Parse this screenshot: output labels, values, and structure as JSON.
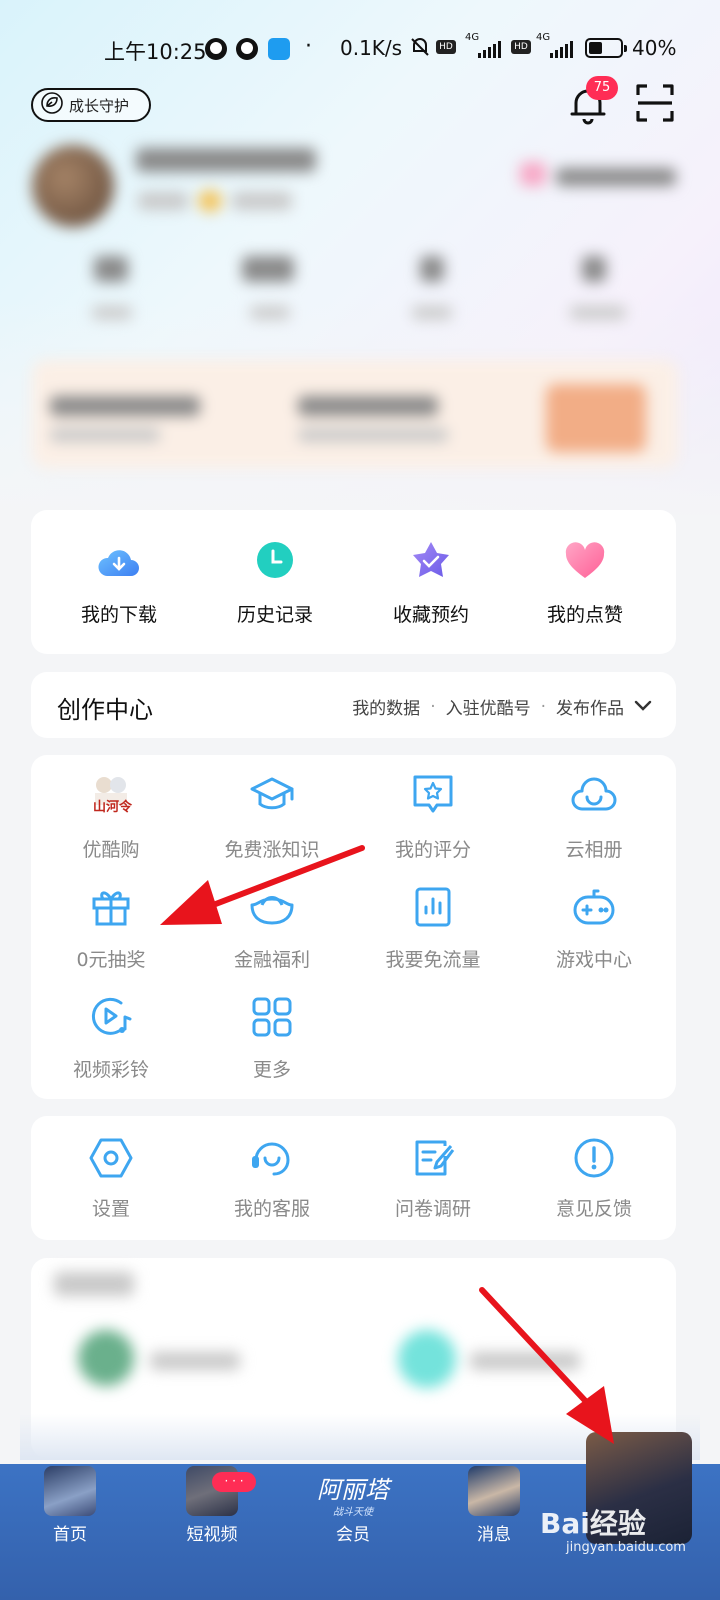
{
  "status_bar": {
    "time": "上午10:25",
    "dot": "·",
    "speed": "0.1K/s",
    "hd": "HD",
    "network": "4G",
    "battery": "40%"
  },
  "header": {
    "guard_label": "成长守护",
    "notification_count": "75"
  },
  "quick_actions": [
    {
      "label": "我的下载",
      "icon": "download-cloud-icon"
    },
    {
      "label": "历史记录",
      "icon": "clock-icon"
    },
    {
      "label": "收藏预约",
      "icon": "star-check-icon"
    },
    {
      "label": "我的点赞",
      "icon": "heart-icon"
    }
  ],
  "creation_center": {
    "title": "创作中心",
    "links": [
      "我的数据",
      "入驻优酷号",
      "发布作品"
    ],
    "separator": "·"
  },
  "services": [
    {
      "label": "优酷购",
      "icon": "youku-shop-icon"
    },
    {
      "label": "免费涨知识",
      "icon": "graduation-cap-icon"
    },
    {
      "label": "我的评分",
      "icon": "rating-star-icon"
    },
    {
      "label": "云相册",
      "icon": "cloud-smile-icon"
    },
    {
      "label": "0元抽奖",
      "icon": "gift-icon"
    },
    {
      "label": "金融福利",
      "icon": "gold-ingot-icon"
    },
    {
      "label": "我要免流量",
      "icon": "data-chart-icon"
    },
    {
      "label": "游戏中心",
      "icon": "gamepad-icon"
    },
    {
      "label": "视频彩铃",
      "icon": "video-ringtone-icon"
    },
    {
      "label": "更多",
      "icon": "grid-more-icon"
    }
  ],
  "tools": [
    {
      "label": "设置",
      "icon": "settings-hexagon-icon"
    },
    {
      "label": "我的客服",
      "icon": "headset-icon"
    },
    {
      "label": "问卷调研",
      "icon": "survey-edit-icon"
    },
    {
      "label": "意见反馈",
      "icon": "alert-circle-icon"
    }
  ],
  "bottom_nav": [
    {
      "label": "首页"
    },
    {
      "label": "短视频",
      "badge": "· · ·"
    },
    {
      "label": "会员",
      "logo_text": "阿丽塔",
      "logo_sub": "战斗天使"
    },
    {
      "label": "消息"
    }
  ],
  "watermark": {
    "brand": "Bai经验",
    "url": "jingyan.baidu.com"
  },
  "colors": {
    "accent_blue": "#3ea6f0",
    "nav_blue": "#3a6bb8",
    "badge_red": "#ff2d55",
    "arrow_red": "#e8141c"
  }
}
